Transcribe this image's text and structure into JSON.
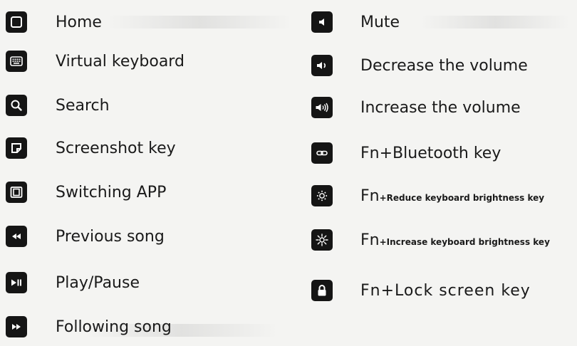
{
  "left_keys": [
    {
      "icon": "home-icon",
      "label": "Home"
    },
    {
      "icon": "virtual-keyboard-icon",
      "label": "Virtual keyboard"
    },
    {
      "icon": "search-icon",
      "label": "Search"
    },
    {
      "icon": "screenshot-icon",
      "label": "Screenshot key"
    },
    {
      "icon": "switch-app-icon",
      "label": "Switching APP"
    },
    {
      "icon": "previous-song-icon",
      "label": "Previous song"
    },
    {
      "icon": "play-pause-icon",
      "label": "Play/Pause"
    },
    {
      "icon": "next-song-icon",
      "label": "Following song"
    }
  ],
  "right_keys": [
    {
      "icon": "mute-icon",
      "label": "Mute"
    },
    {
      "icon": "volume-down-icon",
      "label": "Decrease the volume"
    },
    {
      "icon": "volume-up-icon",
      "label": "Increase the volume"
    },
    {
      "icon": "bluetooth-link-icon",
      "fn": "Fn",
      "label": "+Bluetooth key"
    },
    {
      "icon": "brightness-down-icon",
      "fn": "Fn",
      "label": "+Reduce keyboard brightness key"
    },
    {
      "icon": "brightness-up-icon",
      "fn": "Fn",
      "label": "+Increase keyboard brightness key"
    },
    {
      "icon": "lock-icon",
      "label": "Fn+Lock screen key"
    }
  ],
  "colors": {
    "icon_bg": "#151515",
    "icon_fg": "#ffffff",
    "text": "#1a1a1a",
    "page_bg": "#f4f4f2"
  }
}
